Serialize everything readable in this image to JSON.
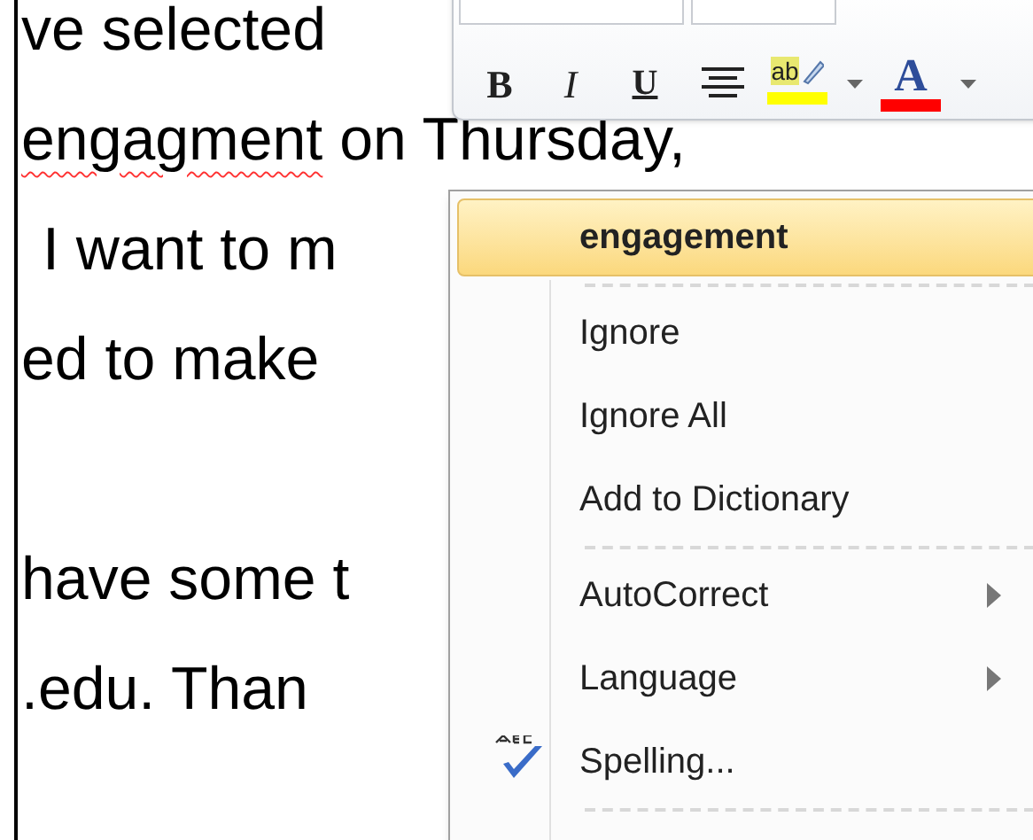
{
  "document": {
    "paragraphs": [
      {
        "lines": [
          {
            "text": "ve selected",
            "misspelled": false,
            "indented": false
          },
          {
            "text": "engagment",
            "rest": " on Thursday,",
            "misspelled": true,
            "indented": false
          },
          {
            "text": "I want to m",
            "misspelled": false,
            "indented": true
          },
          {
            "text": "ed to make",
            "misspelled": false,
            "indented": false
          }
        ]
      },
      {
        "lines": [
          {
            "text": "have some t",
            "misspelled": false,
            "indented": false
          },
          {
            "text": ".edu. Than",
            "misspelled": false,
            "indented": false
          }
        ]
      }
    ]
  },
  "mini_toolbar": {
    "buttons": [
      {
        "kind": "bold",
        "label": "B"
      },
      {
        "kind": "italic",
        "label": "I"
      },
      {
        "kind": "underline",
        "label": "U"
      },
      {
        "kind": "center"
      },
      {
        "kind": "highlight",
        "label": "ab",
        "color": "#ffff00"
      },
      {
        "kind": "caret"
      },
      {
        "kind": "font-color",
        "label": "A",
        "color": "#ff0000"
      },
      {
        "kind": "caret"
      }
    ]
  },
  "context_menu": {
    "items": [
      {
        "kind": "suggestion",
        "label": "engagement",
        "selected": true
      },
      {
        "kind": "separator"
      },
      {
        "kind": "item",
        "label": "Ignore",
        "selected": false
      },
      {
        "kind": "item",
        "label": "Ignore All",
        "selected": false
      },
      {
        "kind": "item",
        "label": "Add to Dictionary",
        "selected": false
      },
      {
        "kind": "separator"
      },
      {
        "kind": "submenu",
        "label": "AutoCorrect",
        "selected": false
      },
      {
        "kind": "submenu",
        "label": "Language",
        "selected": false
      },
      {
        "kind": "spelling",
        "label": "Spelling...",
        "selected": false
      },
      {
        "kind": "separator"
      }
    ]
  }
}
